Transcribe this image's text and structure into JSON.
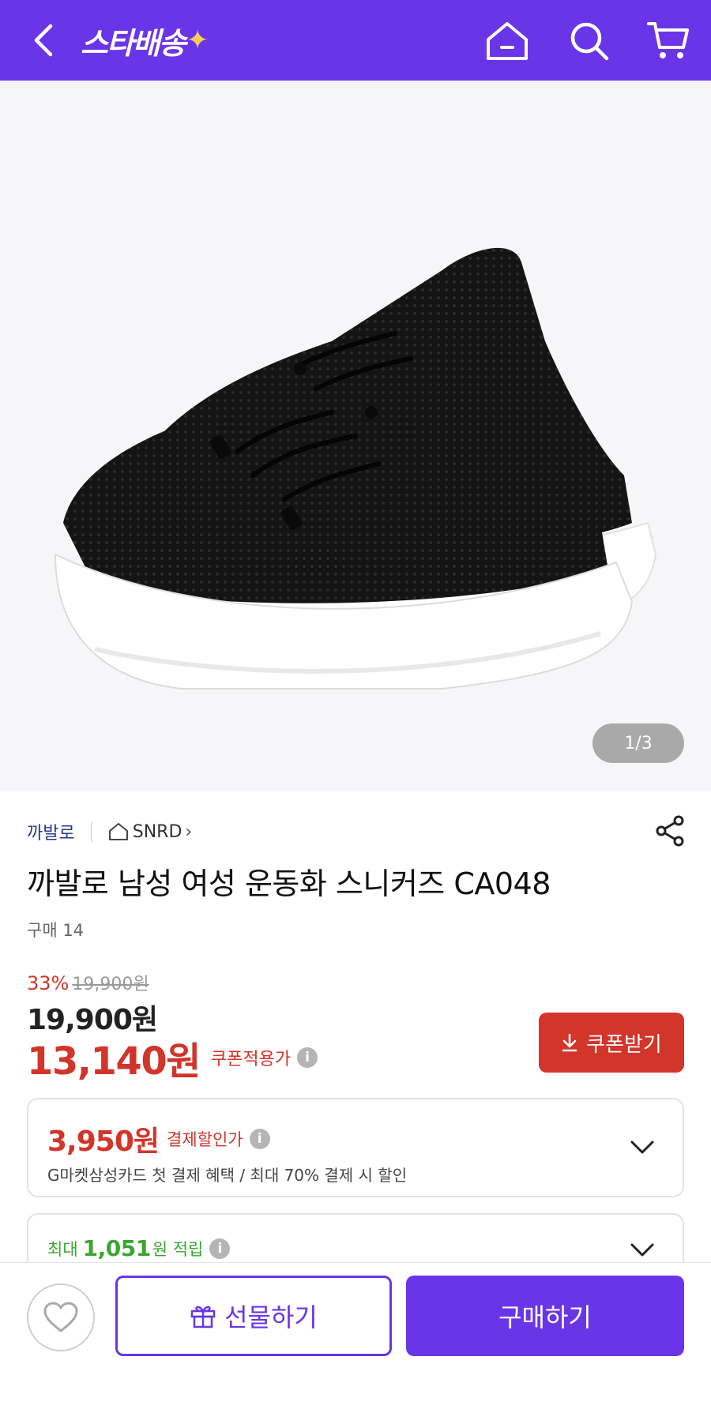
{
  "colors": {
    "brand": "#6a35e8",
    "discount": "#d2352a",
    "points": "#3aa52f"
  },
  "header": {
    "logo_text": "스타배송",
    "icons": [
      "back-icon",
      "home-icon",
      "search-icon",
      "cart-icon"
    ]
  },
  "gallery": {
    "counter": "1/3"
  },
  "product": {
    "brand": "까발로",
    "store": "SNRD",
    "title": "까발로 남성 여성 운동화 스니커즈 CA048",
    "purchases": "구매 14"
  },
  "pricing": {
    "discount_rate": "33%",
    "original_price": "19,900원",
    "sale_price": "19,900원",
    "coupon_price": "13,140원",
    "coupon_label": "쿠폰적용가",
    "coupon_button": "쿠폰받기"
  },
  "payment_card": {
    "amount": "3,950원",
    "label": "결제할인가",
    "desc": "G마켓삼성카드 첫 결제 혜택 / 최대 70% 결제 시 할인"
  },
  "points_card": {
    "prefix": "최대",
    "amount": "1,051",
    "suffix": "원 적립"
  },
  "bottom": {
    "gift_label": "선물하기",
    "buy_label": "구매하기"
  }
}
